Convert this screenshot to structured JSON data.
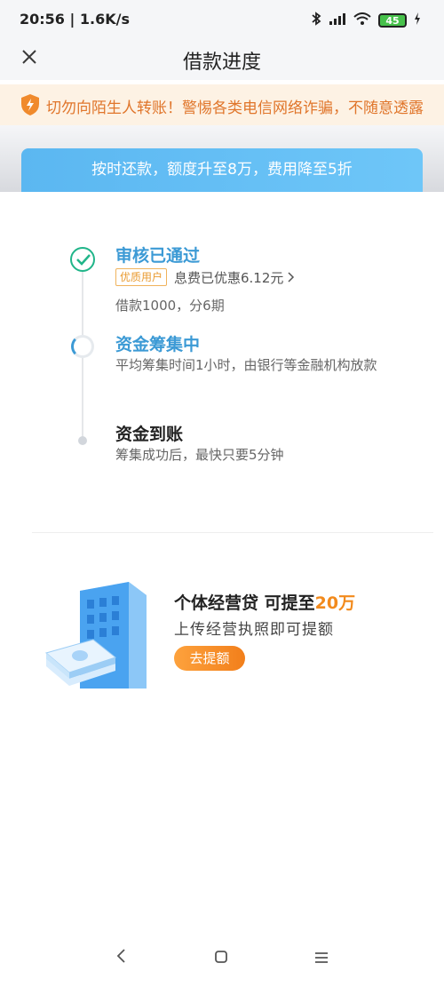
{
  "status_bar": {
    "time_speed": "20:56 | 1.6K/s",
    "battery_level": "45",
    "icons": [
      "bluetooth-icon",
      "signal-icon",
      "wifi-icon",
      "battery-icon",
      "charging-icon"
    ]
  },
  "header": {
    "title": "借款进度",
    "close_icon": "close-icon"
  },
  "warning": {
    "text": "切勿向陌生人转账！警惕各类电信网络诈骗，不随意透露",
    "color": "#e0752a"
  },
  "promo_banner": {
    "text": "按时还款，额度升至8万，费用降至5折"
  },
  "progress": {
    "steps": [
      {
        "title": "审核已通过",
        "badge": "优质用户",
        "discount": "息费已优惠6.12元",
        "detail": "借款1000，分6期",
        "state": "done"
      },
      {
        "title": "资金筹集中",
        "detail": "平均筹集时间1小时，由银行等金融机构放款",
        "state": "in-progress"
      },
      {
        "title": "资金到账",
        "detail": "筹集成功后，最快只要5分钟",
        "state": "pending"
      }
    ]
  },
  "biz_loan": {
    "title_prefix": "个体经营贷  可提至",
    "title_amount": "20万",
    "subtitle": "上传经营执照即可提额",
    "button": "去提额"
  },
  "colors": {
    "accent_blue": "#3c9ad5",
    "success_green": "#20b589",
    "orange": "#f28a1c"
  }
}
